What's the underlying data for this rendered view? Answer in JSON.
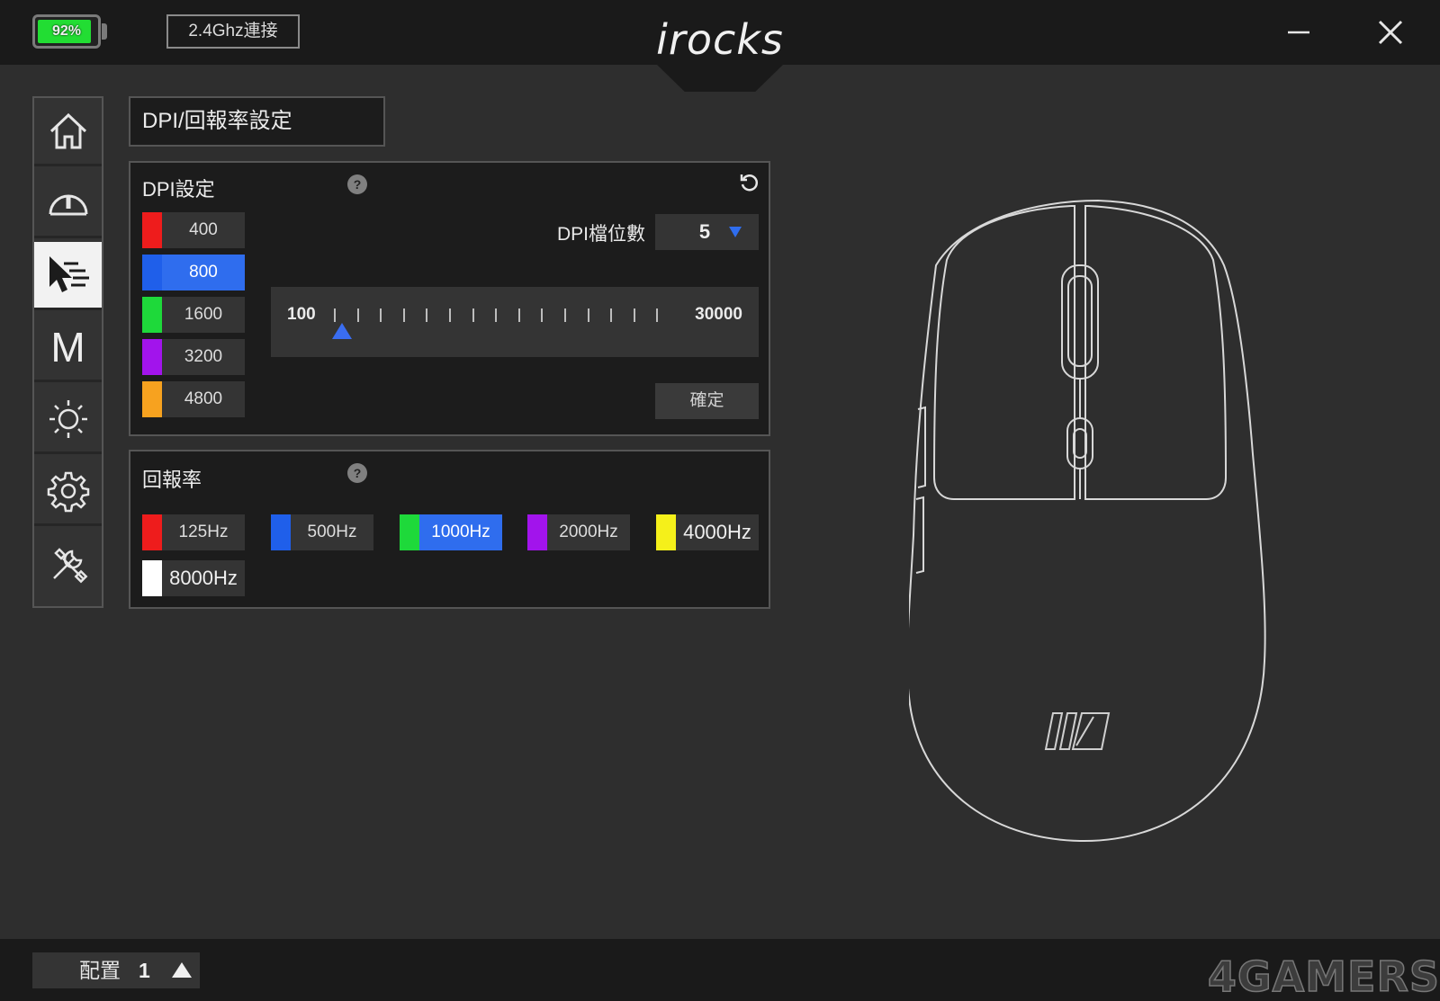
{
  "header": {
    "battery_text": "92%",
    "battery_level": 0.92,
    "connection": "2.4Ghz連接",
    "logo": "irocks",
    "minimize_icon": "minimize-icon",
    "close_icon": "close-icon"
  },
  "nav": {
    "items": [
      {
        "name": "home",
        "icon": "home-icon"
      },
      {
        "name": "performance",
        "icon": "gauge-icon"
      },
      {
        "name": "dpi",
        "icon": "cursor-dpi-icon",
        "active": true
      },
      {
        "name": "macro",
        "icon": "macro-m-icon",
        "label": "M"
      },
      {
        "name": "lighting",
        "icon": "sun-icon"
      },
      {
        "name": "settings",
        "icon": "gear-icon"
      },
      {
        "name": "tools",
        "icon": "tools-icon"
      }
    ]
  },
  "page_title": "DPI/回報率設定",
  "dpi_panel": {
    "title": "DPI設定",
    "help": "?",
    "reset_icon": "reset-icon",
    "stages": [
      {
        "value": "400",
        "color": "#ee1c1c"
      },
      {
        "value": "800",
        "color": "#1f5fea",
        "selected": true
      },
      {
        "value": "1600",
        "color": "#1ed93a"
      },
      {
        "value": "3200",
        "color": "#a214ec"
      },
      {
        "value": "4800",
        "color": "#f7a21f"
      }
    ],
    "stage_count_label": "DPI檔位數",
    "stage_count": "5",
    "slider_min": "100",
    "slider_max": "30000",
    "slider_value": 800,
    "confirm": "確定"
  },
  "rate_panel": {
    "title": "回報率",
    "help": "?",
    "rates": [
      {
        "value": "125Hz",
        "color": "#ee1c1c"
      },
      {
        "value": "500Hz",
        "color": "#1f5fea"
      },
      {
        "value": "1000Hz",
        "color": "#1ed93a",
        "selected": true
      },
      {
        "value": "2000Hz",
        "color": "#a214ec"
      },
      {
        "value": "4000Hz",
        "color": "#f5f01a"
      },
      {
        "value": "8000Hz",
        "color": "#ffffff"
      }
    ]
  },
  "footer": {
    "profile_label": "配置",
    "profile_number": "1",
    "watermark": "4GAMERS"
  },
  "colors": {
    "accent_blue": "#2f6dee",
    "battery_green": "#22dd33",
    "background": "#2e2e2e",
    "bar": "#1a1a1a"
  }
}
